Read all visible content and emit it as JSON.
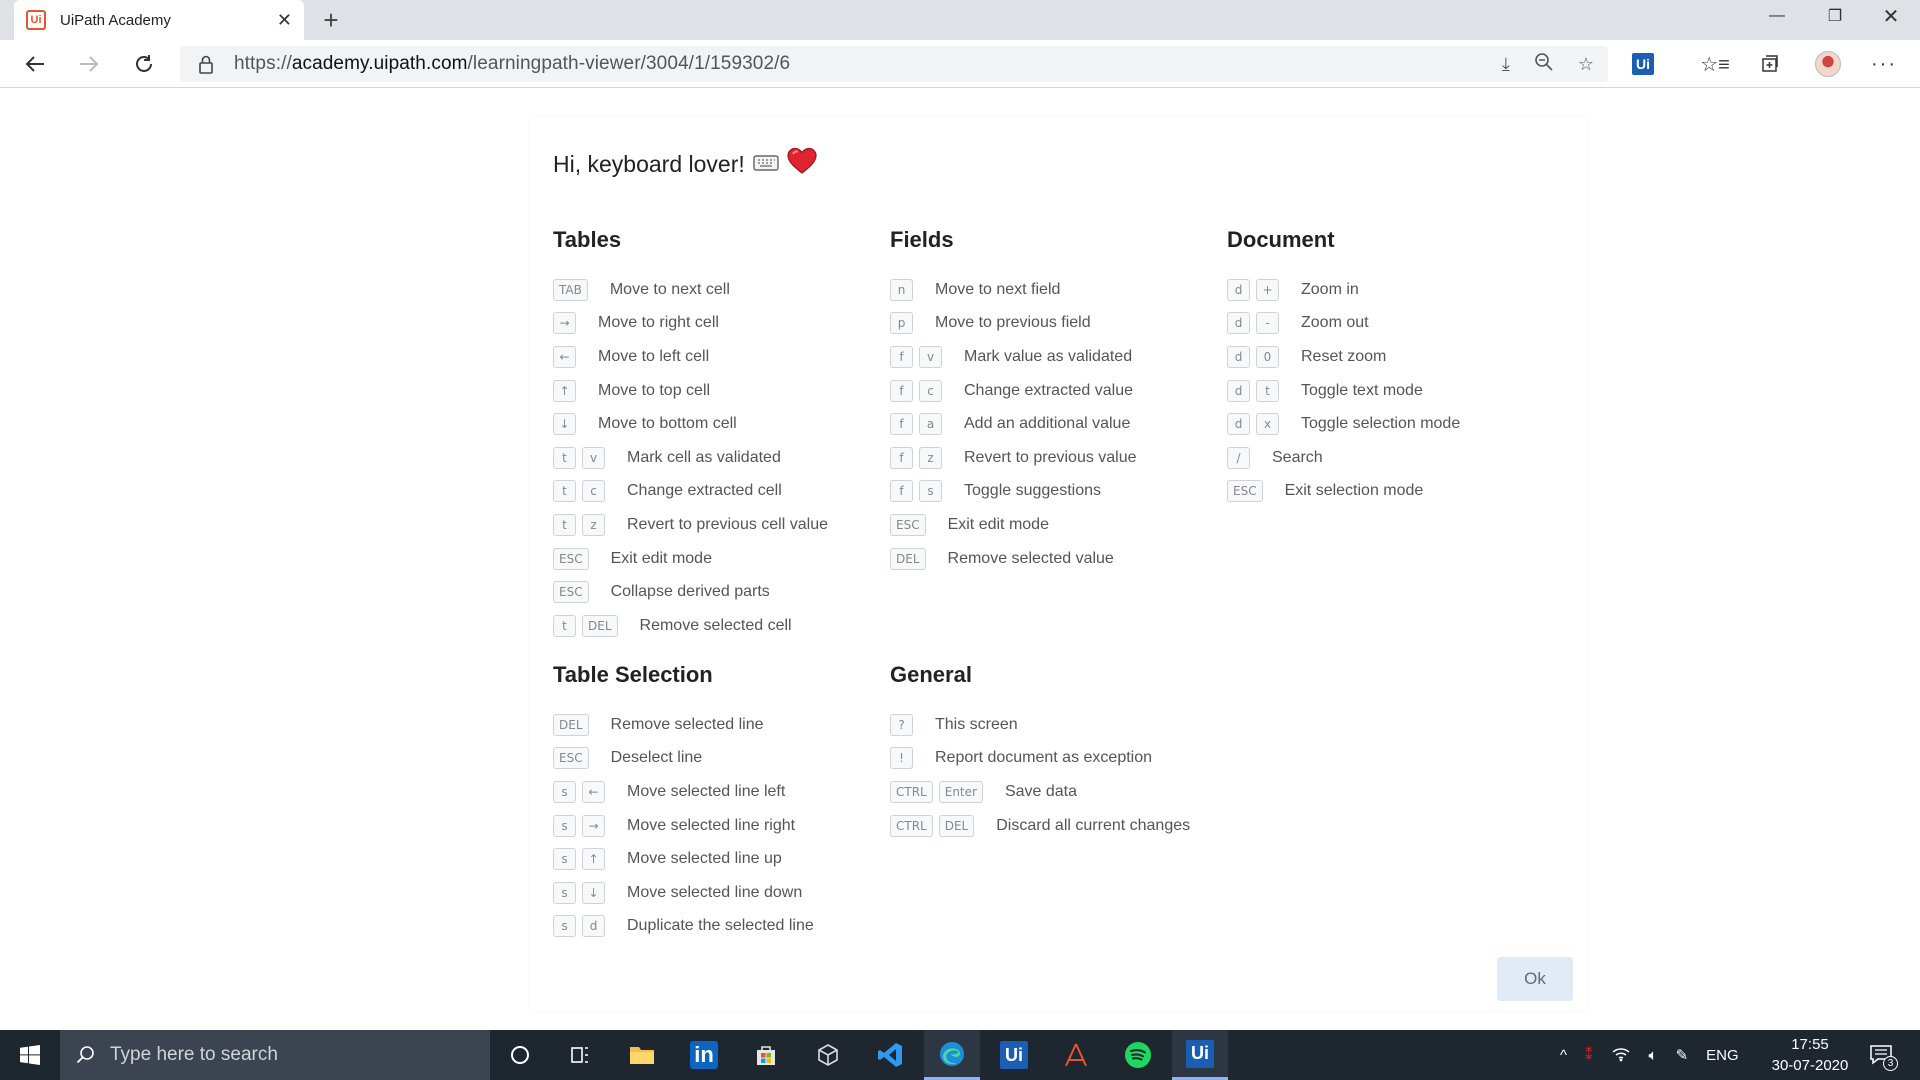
{
  "browser": {
    "tab_title": "UiPath Academy",
    "favicon_text": "Ui",
    "new_tab_label": "+",
    "url_prefix": "https://",
    "url_domain": "academy.uipath.com",
    "url_path": "/learningpath-viewer/3004/1/159302/6",
    "extension_label": "Ui"
  },
  "dialog": {
    "title": "Hi, keyboard lover!",
    "ok_label": "Ok",
    "sections": [
      {
        "title": "Tables",
        "rows": [
          {
            "keys": [
              "TAB"
            ],
            "desc": "Move to next cell"
          },
          {
            "keys": [
              "→"
            ],
            "desc": "Move to right cell"
          },
          {
            "keys": [
              "←"
            ],
            "desc": "Move to left cell"
          },
          {
            "keys": [
              "↑"
            ],
            "desc": "Move to top cell"
          },
          {
            "keys": [
              "↓"
            ],
            "desc": "Move to bottom cell"
          },
          {
            "keys": [
              "t",
              "v"
            ],
            "desc": "Mark cell as validated"
          },
          {
            "keys": [
              "t",
              "c"
            ],
            "desc": "Change extracted cell"
          },
          {
            "keys": [
              "t",
              "z"
            ],
            "desc": "Revert to previous cell value"
          },
          {
            "keys": [
              "ESC"
            ],
            "desc": "Exit edit mode"
          },
          {
            "keys": [
              "ESC"
            ],
            "desc": "Collapse derived parts"
          },
          {
            "keys": [
              "t",
              "DEL"
            ],
            "desc": "Remove selected cell"
          }
        ]
      },
      {
        "title": "Fields",
        "rows": [
          {
            "keys": [
              "n"
            ],
            "desc": "Move to next field"
          },
          {
            "keys": [
              "p"
            ],
            "desc": "Move to previous field"
          },
          {
            "keys": [
              "f",
              "v"
            ],
            "desc": "Mark value as validated"
          },
          {
            "keys": [
              "f",
              "c"
            ],
            "desc": "Change extracted value"
          },
          {
            "keys": [
              "f",
              "a"
            ],
            "desc": "Add an additional value"
          },
          {
            "keys": [
              "f",
              "z"
            ],
            "desc": "Revert to previous value"
          },
          {
            "keys": [
              "f",
              "s"
            ],
            "desc": "Toggle suggestions"
          },
          {
            "keys": [
              "ESC"
            ],
            "desc": "Exit edit mode"
          },
          {
            "keys": [
              "DEL"
            ],
            "desc": "Remove selected value"
          }
        ]
      },
      {
        "title": "Document",
        "rows": [
          {
            "keys": [
              "d",
              "+"
            ],
            "desc": "Zoom in"
          },
          {
            "keys": [
              "d",
              "-"
            ],
            "desc": "Zoom out"
          },
          {
            "keys": [
              "d",
              "0"
            ],
            "desc": "Reset zoom"
          },
          {
            "keys": [
              "d",
              "t"
            ],
            "desc": "Toggle text mode"
          },
          {
            "keys": [
              "d",
              "x"
            ],
            "desc": "Toggle selection mode"
          },
          {
            "keys": [
              "/"
            ],
            "desc": "Search"
          },
          {
            "keys": [
              "ESC"
            ],
            "desc": "Exit selection mode"
          }
        ]
      },
      {
        "title": "Table Selection",
        "rows": [
          {
            "keys": [
              "DEL"
            ],
            "desc": "Remove selected line"
          },
          {
            "keys": [
              "ESC"
            ],
            "desc": "Deselect line"
          },
          {
            "keys": [
              "s",
              "←"
            ],
            "desc": "Move selected line left"
          },
          {
            "keys": [
              "s",
              "→"
            ],
            "desc": "Move selected line right"
          },
          {
            "keys": [
              "s",
              "↑"
            ],
            "desc": "Move selected line up"
          },
          {
            "keys": [
              "s",
              "↓"
            ],
            "desc": "Move selected line down"
          },
          {
            "keys": [
              "s",
              "d"
            ],
            "desc": "Duplicate the selected line"
          }
        ]
      },
      {
        "title": "General",
        "rows": [
          {
            "keys": [
              "?"
            ],
            "desc": "This screen"
          },
          {
            "keys": [
              "!"
            ],
            "desc": "Report document as exception"
          },
          {
            "keys": [
              "CTRL",
              "Enter"
            ],
            "desc": "Save data"
          },
          {
            "keys": [
              "CTRL",
              "DEL"
            ],
            "desc": "Discard all current changes"
          }
        ]
      }
    ]
  },
  "taskbar": {
    "search_placeholder": "Type here to search",
    "language": "ENG",
    "time": "17:55",
    "date": "30-07-2020",
    "notification_count": "3",
    "uipath_label": "Ui",
    "linkedin_label": "in"
  },
  "colors": {
    "accent": "#1a5fb4",
    "ok_button_bg": "#e1ebf6",
    "taskbar_bg": "#1e2630",
    "uipath_orange": "#e8542d"
  }
}
